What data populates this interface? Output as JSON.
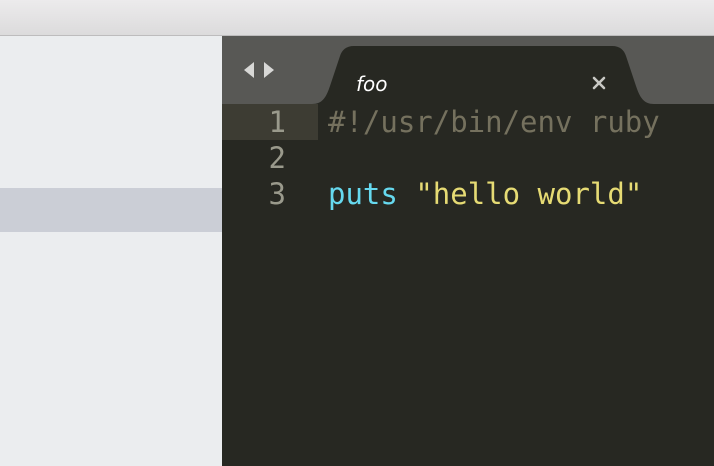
{
  "tab": {
    "title": "foo",
    "close_label": "×"
  },
  "editor": {
    "lines": [
      {
        "number": "1",
        "code": "#!/usr/bin/env ruby"
      },
      {
        "number": "2",
        "code": ""
      },
      {
        "number": "3",
        "keyword": "puts",
        "space": " ",
        "string": "\"hello world\""
      }
    ]
  },
  "icons": {
    "nav_back": "chevron-left-icon",
    "nav_forward": "chevron-right-icon",
    "close": "close-icon"
  },
  "colors": {
    "editor_background": "#272822",
    "tab_bar": "#585855",
    "comment": "#75715e",
    "keyword": "#66d9ef",
    "string": "#e6db74",
    "line_number": "#9a9a8c",
    "sidebar_background": "#ebedef",
    "sidebar_selection": "#cbced6"
  }
}
